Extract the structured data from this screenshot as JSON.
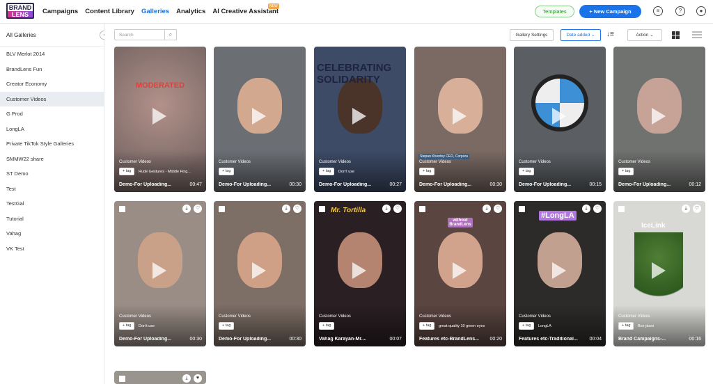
{
  "logo": {
    "line1": "BRAND",
    "line2": "LENS"
  },
  "nav": {
    "items": [
      {
        "label": "Campaigns"
      },
      {
        "label": "Content Library"
      },
      {
        "label": "Galleries"
      },
      {
        "label": "Analytics"
      },
      {
        "label": "AI Creative Assistant"
      }
    ],
    "new_badge": "NEW"
  },
  "header": {
    "templates": "Templates",
    "new_campaign": "+ New Campaign"
  },
  "sidebar": {
    "title": "All Galleries",
    "items": [
      {
        "label": "BLV Merlot 2014"
      },
      {
        "label": "BrandLens Fun"
      },
      {
        "label": "Creator Economy"
      },
      {
        "label": "Customer Videos"
      },
      {
        "label": "G Prod"
      },
      {
        "label": "LongLA"
      },
      {
        "label": "Private TikTok Style Galleries"
      },
      {
        "label": "SMMW22 share"
      },
      {
        "label": "ST Demo"
      },
      {
        "label": "Test"
      },
      {
        "label": "TestGal"
      },
      {
        "label": "Tutorial"
      },
      {
        "label": "Vahag"
      },
      {
        "label": "VK Test"
      }
    ]
  },
  "toolbar": {
    "search_placeholder": "Search",
    "gallery_settings": "Gallery Settings",
    "sort": "Date added",
    "action": "Action"
  },
  "cards": [
    {
      "category": "Customer Videos",
      "tag_btn": "+ tag",
      "tag": "Rude Gestures - Middle Fing...",
      "title": "Demo-For Uploading...",
      "duration": "00:47",
      "overlay": "MODERATED"
    },
    {
      "category": "Customer Videos",
      "tag_btn": "+ tag",
      "tag": "",
      "title": "Demo-For Uploading...",
      "duration": "00:30"
    },
    {
      "category": "Customer Videos",
      "tag_btn": "+ tag",
      "tag": "Don't use",
      "title": "Demo-For Uploading...",
      "duration": "00:27",
      "overlay": "CELEBRATING SOLIDARITY"
    },
    {
      "category": "Customer Videos",
      "tag_btn": "+ tag",
      "tag": "",
      "title": "Demo-For Uploading...",
      "duration": "00:30",
      "overlay": "Stepan Khordoy CEO, Corpora"
    },
    {
      "category": "Customer Videos",
      "tag_btn": "+ tag",
      "tag": "",
      "title": "Demo-For Uploading...",
      "duration": "00:15"
    },
    {
      "category": "Customer Videos",
      "tag_btn": "+ tag",
      "tag": "",
      "title": "Demo-For Uploading...",
      "duration": "00:12"
    },
    {
      "category": "Customer Videos",
      "tag_btn": "+ tag",
      "tag": "Don't use",
      "title": "Demo-For Uploading...",
      "duration": "00:30"
    },
    {
      "category": "Customer Videos",
      "tag_btn": "+ tag",
      "tag": "",
      "title": "Demo-For Uploading...",
      "duration": "00:30"
    },
    {
      "category": "Customer Videos",
      "tag_btn": "+ tag",
      "tag": "",
      "title": "Vahag Karayan-Mr....",
      "duration": "00:07",
      "overlay": "Mr. Tortilla"
    },
    {
      "category": "Customer Videos",
      "tag_btn": "+ tag",
      "tag": "great quality 10 green eyes",
      "title": "Features etc-BrandLens...",
      "duration": "00:20",
      "overlay": "without BrandLens"
    },
    {
      "category": "Customer Videos",
      "tag_btn": "+ tag",
      "tag": "LongLA",
      "title": "Features etc-Traditional...",
      "duration": "00:04",
      "overlay": "#LongLA"
    },
    {
      "category": "Customer Videos",
      "tag_btn": "+ tag",
      "tag": "Box plant",
      "title": "Brand Campaigns-...",
      "duration": "00:16",
      "overlay": "IceLink"
    }
  ],
  "colors": {
    "accent": "#1a73e8",
    "brand_pink": "#d6338c",
    "templates_green": "#2f8f2c"
  }
}
